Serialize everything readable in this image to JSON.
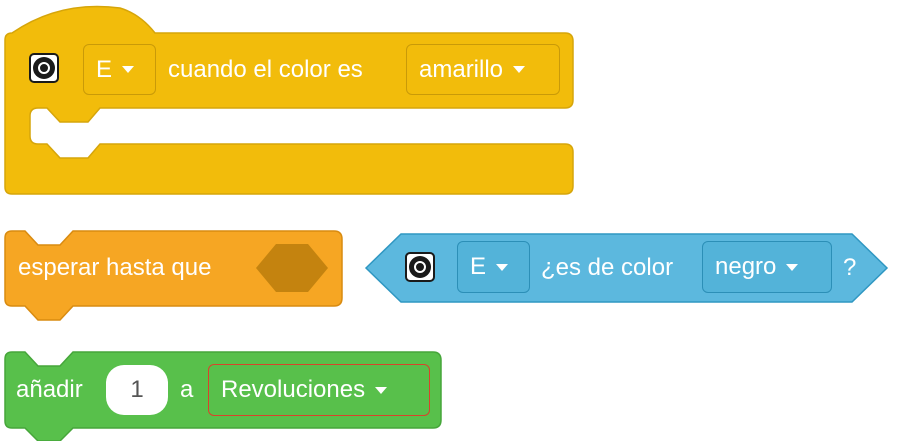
{
  "block_when_color": {
    "port": "E",
    "text": "cuando el color es",
    "color_value": "amarillo",
    "fill": "#f2bc0b"
  },
  "block_wait_until": {
    "text": "esperar hasta que",
    "fill": "#f6a623"
  },
  "block_is_color": {
    "port": "E",
    "text": "¿es de color",
    "color_value": "negro",
    "suffix": "?",
    "fill": "#5cb8de"
  },
  "block_add_to_var": {
    "text": "añadir",
    "amount": "1",
    "connector": "a",
    "variable": "Revoluciones",
    "fill": "#58c04b"
  },
  "icons": {
    "sensor": "color-sensor-icon",
    "caret": "caret-down-icon"
  }
}
